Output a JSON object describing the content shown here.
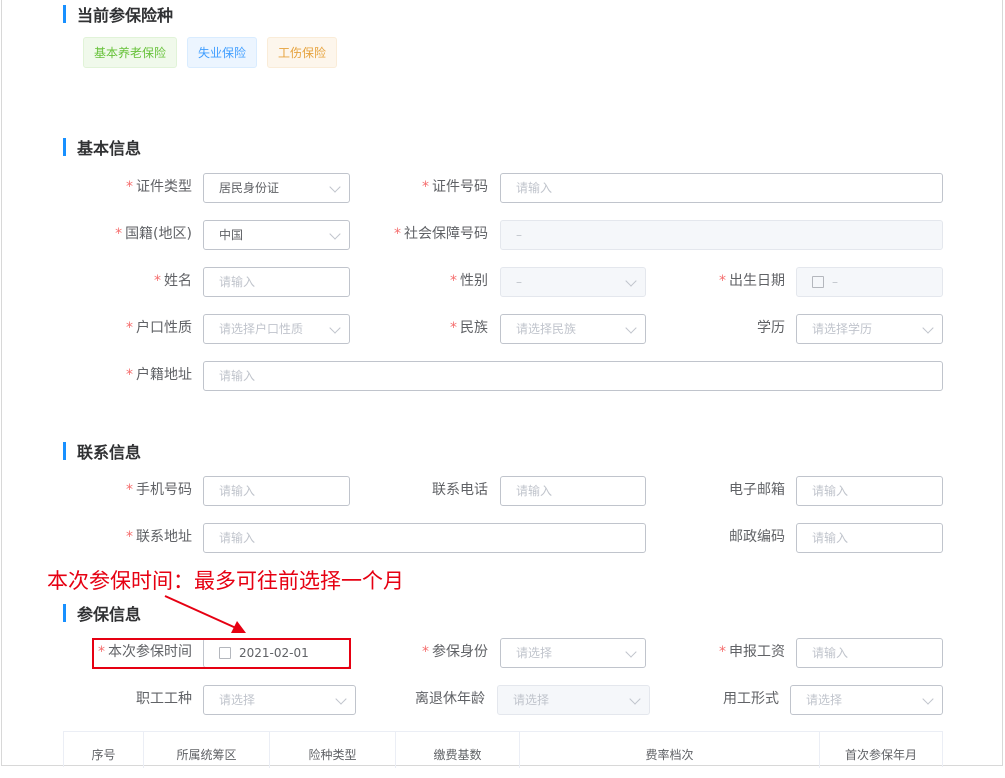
{
  "current_insurance": {
    "title": "当前参保险种",
    "tags": [
      "基本养老保险",
      "失业保险",
      "工伤保险"
    ]
  },
  "basic_info": {
    "title": "基本信息",
    "id_type": {
      "label": "证件类型",
      "value": "居民身份证"
    },
    "id_number": {
      "label": "证件号码",
      "placeholder": "请输入"
    },
    "nationality": {
      "label": "国籍(地区)",
      "value": "中国"
    },
    "social_security_number": {
      "label": "社会保障号码",
      "value": "–"
    },
    "name": {
      "label": "姓名",
      "placeholder": "请输入"
    },
    "gender": {
      "label": "性别",
      "value": "–"
    },
    "birth_date": {
      "label": "出生日期",
      "value": "–"
    },
    "household_type": {
      "label": "户口性质",
      "placeholder": "请选择户口性质"
    },
    "ethnicity": {
      "label": "民族",
      "placeholder": "请选择民族"
    },
    "education": {
      "label": "学历",
      "placeholder": "请选择学历"
    },
    "household_address": {
      "label": "户籍地址",
      "placeholder": "请输入"
    }
  },
  "contact_info": {
    "title": "联系信息",
    "mobile": {
      "label": "手机号码",
      "placeholder": "请输入"
    },
    "phone": {
      "label": "联系电话",
      "placeholder": "请输入"
    },
    "email": {
      "label": "电子邮箱",
      "placeholder": "请输入"
    },
    "address": {
      "label": "联系地址",
      "placeholder": "请输入"
    },
    "postcode": {
      "label": "邮政编码",
      "placeholder": "请输入"
    }
  },
  "annotation": "本次参保时间：最多可往前选择一个月",
  "insurance_info": {
    "title": "参保信息",
    "insure_time": {
      "label": "本次参保时间",
      "value": "2021-02-01"
    },
    "insure_identity": {
      "label": "参保身份",
      "placeholder": "请选择"
    },
    "declared_wage": {
      "label": "申报工资",
      "placeholder": "请输入"
    },
    "job_type": {
      "label": "职工工种",
      "placeholder": "请选择"
    },
    "retire_age": {
      "label": "离退休年龄",
      "placeholder": "请选择"
    },
    "employment_form": {
      "label": "用工形式",
      "placeholder": "请选择"
    }
  },
  "table": {
    "headers": [
      "序号",
      "所属统筹区",
      "险种类型",
      "缴费基数",
      "费率档次",
      "首次参保年月"
    ]
  },
  "colors": {
    "accent": "#1890ff",
    "required": "#f56c6c",
    "annotation": "#e60012"
  }
}
